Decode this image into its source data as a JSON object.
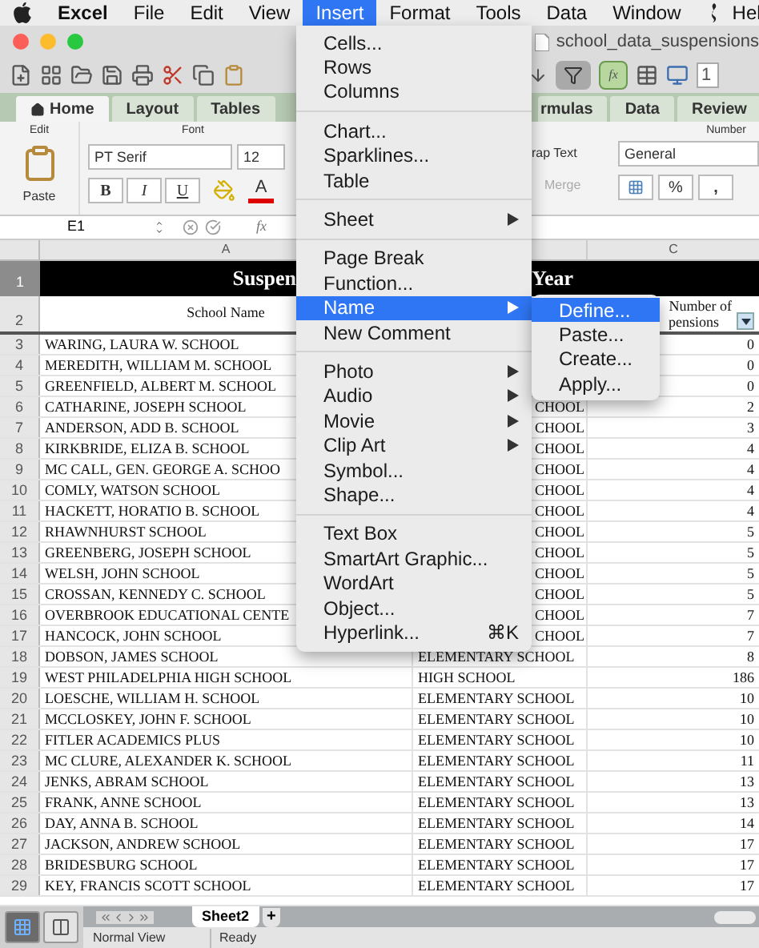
{
  "menubar": {
    "app": "Excel",
    "items": [
      {
        "label": "File",
        "selected": false
      },
      {
        "label": "Edit",
        "selected": false
      },
      {
        "label": "View",
        "selected": false
      },
      {
        "label": "Insert",
        "selected": true
      },
      {
        "label": "Format",
        "selected": false
      },
      {
        "label": "Tools",
        "selected": false
      },
      {
        "label": "Data",
        "selected": false
      },
      {
        "label": "Window",
        "selected": false
      },
      {
        "label": "Hel",
        "selected": false
      }
    ]
  },
  "window": {
    "title": "school_data_suspensions",
    "zoom": "1",
    "function_button": "fx"
  },
  "ribbon_tabs": [
    {
      "label": "Home",
      "selected": true
    },
    {
      "label": "Layout",
      "selected": false
    },
    {
      "label": "Tables",
      "selected": false
    },
    {
      "label": "rmulas",
      "selected": false
    },
    {
      "label": "Data",
      "selected": false
    },
    {
      "label": "Review",
      "selected": false
    }
  ],
  "ribbon": {
    "edit_group": "Edit",
    "paste": "Paste",
    "font_group": "Font",
    "font": "PT Serif",
    "size": "12",
    "bold": "B",
    "italic": "I",
    "underline": "U",
    "font_color": "A",
    "wrap": "rap Text",
    "merge": "Merge",
    "number_group": "Number",
    "number_format": "General",
    "percent": "%",
    "comma": ","
  },
  "formula_bar": {
    "cell": "E1",
    "fx": "fx"
  },
  "columns": [
    "A",
    "C"
  ],
  "title_row": {
    "number": "1",
    "left": "Suspen",
    "right": "Year"
  },
  "header_row": {
    "number": "2",
    "a": "School Name",
    "c": [
      "Number of",
      "pensions"
    ]
  },
  "rows": [
    {
      "n": "3",
      "a": "WARING, LAURA W. SCHOOL",
      "c": "0"
    },
    {
      "n": "4",
      "a": "MEREDITH, WILLIAM M. SCHOOL",
      "c": "0"
    },
    {
      "n": "5",
      "a": "GREENFIELD, ALBERT M. SCHOOL",
      "c": "0"
    },
    {
      "n": "6",
      "a": "CATHARINE, JOSEPH SCHOOL",
      "b": "CHOOL",
      "b_cut": true,
      "c": "2"
    },
    {
      "n": "7",
      "a": "ANDERSON, ADD B. SCHOOL",
      "b": "CHOOL",
      "b_cut": true,
      "c": "3"
    },
    {
      "n": "8",
      "a": "KIRKBRIDE, ELIZA B. SCHOOL",
      "b": "CHOOL",
      "b_cut": true,
      "c": "4"
    },
    {
      "n": "9",
      "a": "MC CALL, GEN. GEORGE A. SCHOO",
      "b": "CHOOL",
      "b_cut": true,
      "c": "4"
    },
    {
      "n": "10",
      "a": "COMLY, WATSON SCHOOL",
      "b": "CHOOL",
      "b_cut": true,
      "c": "4"
    },
    {
      "n": "11",
      "a": "HACKETT, HORATIO B. SCHOOL",
      "b": "CHOOL",
      "b_cut": true,
      "c": "4"
    },
    {
      "n": "12",
      "a": "RHAWNHURST SCHOOL",
      "b": "CHOOL",
      "b_cut": true,
      "c": "5"
    },
    {
      "n": "13",
      "a": "GREENBERG, JOSEPH SCHOOL",
      "b": "CHOOL",
      "b_cut": true,
      "c": "5"
    },
    {
      "n": "14",
      "a": "WELSH, JOHN SCHOOL",
      "b": "CHOOL",
      "b_cut": true,
      "c": "5"
    },
    {
      "n": "15",
      "a": "CROSSAN, KENNEDY C. SCHOOL",
      "b": "CHOOL",
      "b_cut": true,
      "c": "5"
    },
    {
      "n": "16",
      "a": "OVERBROOK EDUCATIONAL CENTE",
      "b": "CHOOL",
      "b_cut": true,
      "c": "7"
    },
    {
      "n": "17",
      "a": "HANCOCK, JOHN SCHOOL",
      "b": "CHOOL",
      "b_cut": true,
      "c": "7"
    },
    {
      "n": "18",
      "a": "DOBSON, JAMES SCHOOL",
      "b": "ELEMENTARY SCHOOL",
      "b_cut": false,
      "c": "8"
    },
    {
      "n": "19",
      "a": "WEST PHILADELPHIA HIGH SCHOOL",
      "b": "HIGH SCHOOL",
      "b_cut": false,
      "c": "186"
    },
    {
      "n": "20",
      "a": "LOESCHE, WILLIAM H. SCHOOL",
      "b": "ELEMENTARY SCHOOL",
      "b_cut": false,
      "c": "10"
    },
    {
      "n": "21",
      "a": "MCCLOSKEY, JOHN F. SCHOOL",
      "b": "ELEMENTARY SCHOOL",
      "b_cut": false,
      "c": "10"
    },
    {
      "n": "22",
      "a": "FITLER ACADEMICS PLUS",
      "b": "ELEMENTARY SCHOOL",
      "b_cut": false,
      "c": "10"
    },
    {
      "n": "23",
      "a": "MC CLURE, ALEXANDER K. SCHOOL",
      "b": "ELEMENTARY SCHOOL",
      "b_cut": false,
      "c": "11"
    },
    {
      "n": "24",
      "a": "JENKS, ABRAM SCHOOL",
      "b": "ELEMENTARY SCHOOL",
      "b_cut": false,
      "c": "13"
    },
    {
      "n": "25",
      "a": "FRANK, ANNE SCHOOL",
      "b": "ELEMENTARY SCHOOL",
      "b_cut": false,
      "c": "13"
    },
    {
      "n": "26",
      "a": "DAY, ANNA B. SCHOOL",
      "b": "ELEMENTARY SCHOOL",
      "b_cut": false,
      "c": "14"
    },
    {
      "n": "27",
      "a": "JACKSON, ANDREW SCHOOL",
      "b": "ELEMENTARY SCHOOL",
      "b_cut": false,
      "c": "17"
    },
    {
      "n": "28",
      "a": "BRIDESBURG SCHOOL",
      "b": "ELEMENTARY SCHOOL",
      "b_cut": false,
      "c": "17"
    },
    {
      "n": "29",
      "a": "KEY, FRANCIS SCOTT SCHOOL",
      "b": "ELEMENTARY SCHOOL",
      "b_cut": false,
      "c": "17"
    }
  ],
  "insert_menu": [
    [
      {
        "label": "Cells...",
        "submenu": false,
        "selected": false
      },
      {
        "label": "Rows",
        "submenu": false,
        "selected": false
      },
      {
        "label": "Columns",
        "submenu": false,
        "selected": false
      }
    ],
    [
      {
        "label": "Chart...",
        "submenu": false,
        "selected": false
      },
      {
        "label": "Sparklines...",
        "submenu": false,
        "selected": false
      },
      {
        "label": "Table",
        "submenu": false,
        "selected": false
      }
    ],
    [
      {
        "label": "Sheet",
        "submenu": true,
        "selected": false
      }
    ],
    [
      {
        "label": "Page Break",
        "submenu": false,
        "selected": false
      },
      {
        "label": "Function...",
        "submenu": false,
        "selected": false
      },
      {
        "label": "Name",
        "submenu": true,
        "selected": true
      },
      {
        "label": "New Comment",
        "submenu": false,
        "selected": false
      }
    ],
    [
      {
        "label": "Photo",
        "submenu": true,
        "selected": false
      },
      {
        "label": "Audio",
        "submenu": true,
        "selected": false
      },
      {
        "label": "Movie",
        "submenu": true,
        "selected": false
      },
      {
        "label": "Clip Art",
        "submenu": true,
        "selected": false
      },
      {
        "label": "Symbol...",
        "submenu": false,
        "selected": false
      },
      {
        "label": "Shape...",
        "submenu": false,
        "selected": false
      }
    ],
    [
      {
        "label": "Text Box",
        "submenu": false,
        "selected": false
      },
      {
        "label": "SmartArt Graphic...",
        "submenu": false,
        "selected": false
      },
      {
        "label": "WordArt",
        "submenu": false,
        "selected": false
      },
      {
        "label": "Object...",
        "submenu": false,
        "selected": false
      },
      {
        "label": "Hyperlink...",
        "submenu": false,
        "selected": false,
        "shortcut": "⌘K"
      }
    ]
  ],
  "name_submenu": [
    {
      "label": "Define...",
      "selected": true
    },
    {
      "label": "Paste...",
      "selected": false
    },
    {
      "label": "Create...",
      "selected": false
    },
    {
      "label": "Apply...",
      "selected": false
    }
  ],
  "sheet_tabs": [
    {
      "label": "Sheet2",
      "selected": true
    }
  ],
  "add_sheet": "+",
  "view_buttons": [
    {
      "kind": "normal",
      "selected": true
    },
    {
      "kind": "layout",
      "selected": false
    }
  ],
  "status_bar": {
    "view": "Normal View",
    "state": "Ready"
  }
}
